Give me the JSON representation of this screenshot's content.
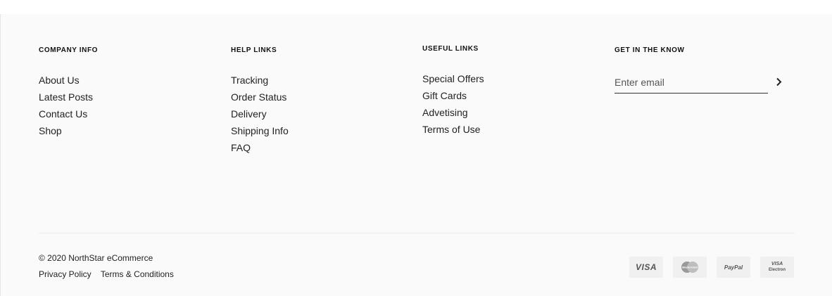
{
  "company_info": {
    "heading": "COMPANY INFO",
    "links": [
      "About Us",
      "Latest Posts",
      "Contact Us",
      "Shop"
    ]
  },
  "help_links": {
    "heading": "HELP LINKS",
    "links": [
      "Tracking",
      "Order Status",
      "Delivery",
      "Shipping Info",
      "FAQ"
    ]
  },
  "useful_links": {
    "heading": "USEFUL LINKS",
    "links": [
      "Special Offers",
      "Gift Cards",
      "Advetising",
      "Terms of Use"
    ]
  },
  "newsletter": {
    "heading": "GET IN THE KNOW",
    "placeholder": "Enter email",
    "value": ""
  },
  "bottom": {
    "copyright": "© 2020 NorthStar eCommerce",
    "privacy": "Privacy Policy",
    "terms": "Terms & Conditions"
  },
  "payments": {
    "visa": "VISA",
    "mastercard": "MasterCard",
    "paypal": "PayPal",
    "visa_electron_top": "VISA",
    "visa_electron_bottom": "Electron"
  },
  "icons": {
    "submit": "chevron-right-icon"
  }
}
